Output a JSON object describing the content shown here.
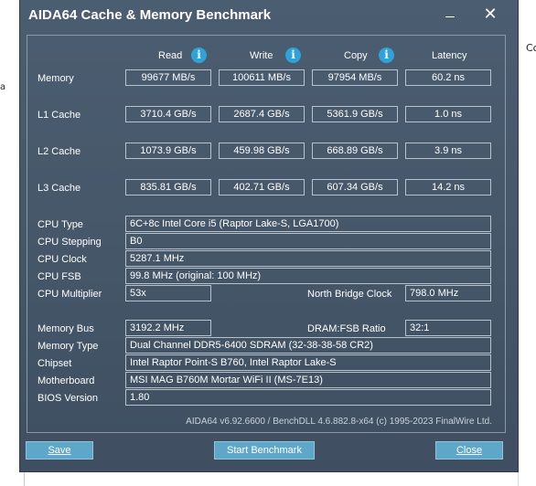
{
  "background": {
    "left_fragment": "a",
    "right_fragment": "Co"
  },
  "window": {
    "title": "AIDA64 Cache & Memory Benchmark",
    "minimize_glyph": "—",
    "close_glyph": "✕"
  },
  "columns": {
    "read": "Read",
    "write": "Write",
    "copy": "Copy",
    "latency": "Latency",
    "info_glyph": "i"
  },
  "rows": {
    "memory": {
      "label": "Memory",
      "read": "99677 MB/s",
      "write": "100611 MB/s",
      "copy": "97954 MB/s",
      "latency": "60.2 ns"
    },
    "l1": {
      "label": "L1 Cache",
      "read": "3710.4 GB/s",
      "write": "2687.4 GB/s",
      "copy": "5361.9 GB/s",
      "latency": "1.0 ns"
    },
    "l2": {
      "label": "L2 Cache",
      "read": "1073.9 GB/s",
      "write": "459.98 GB/s",
      "copy": "668.89 GB/s",
      "latency": "3.9 ns"
    },
    "l3": {
      "label": "L3 Cache",
      "read": "835.81 GB/s",
      "write": "402.71 GB/s",
      "copy": "607.34 GB/s",
      "latency": "14.2 ns"
    }
  },
  "cpu": {
    "type_label": "CPU Type",
    "type_value": "6C+8c Intel Core i5  (Raptor Lake-S, LGA1700)",
    "stepping_label": "CPU Stepping",
    "stepping_value": "B0",
    "clock_label": "CPU Clock",
    "clock_value": "5287.1 MHz",
    "fsb_label": "CPU FSB",
    "fsb_value": "99.8 MHz  (original: 100 MHz)",
    "multiplier_label": "CPU Multiplier",
    "multiplier_value": "53x",
    "nb_clock_label": "North Bridge Clock",
    "nb_clock_value": "798.0 MHz"
  },
  "memory_info": {
    "bus_label": "Memory Bus",
    "bus_value": "3192.2 MHz",
    "ratio_label": "DRAM:FSB Ratio",
    "ratio_value": "32:1",
    "type_label": "Memory Type",
    "type_value": "Dual Channel DDR5-6400 SDRAM  (32-38-38-58 CR2)",
    "chipset_label": "Chipset",
    "chipset_value": "Intel Raptor Point-S B760, Intel Raptor Lake-S",
    "motherboard_label": "Motherboard",
    "motherboard_value": "MSI MAG B760M Mortar WiFi II (MS-7E13)",
    "bios_label": "BIOS Version",
    "bios_value": "1.80"
  },
  "footer": {
    "version": "AIDA64 v6.92.6600 / BenchDLL 4.6.882.8-x64  (c) 1995-2023 FinalWire Ltd."
  },
  "buttons": {
    "save": "Save",
    "start": "Start Benchmark",
    "close": "Close"
  },
  "colors": {
    "window_bg": "#46576a",
    "info_icon": "#2fa3d9",
    "button_bg": "#5fa7c8"
  }
}
